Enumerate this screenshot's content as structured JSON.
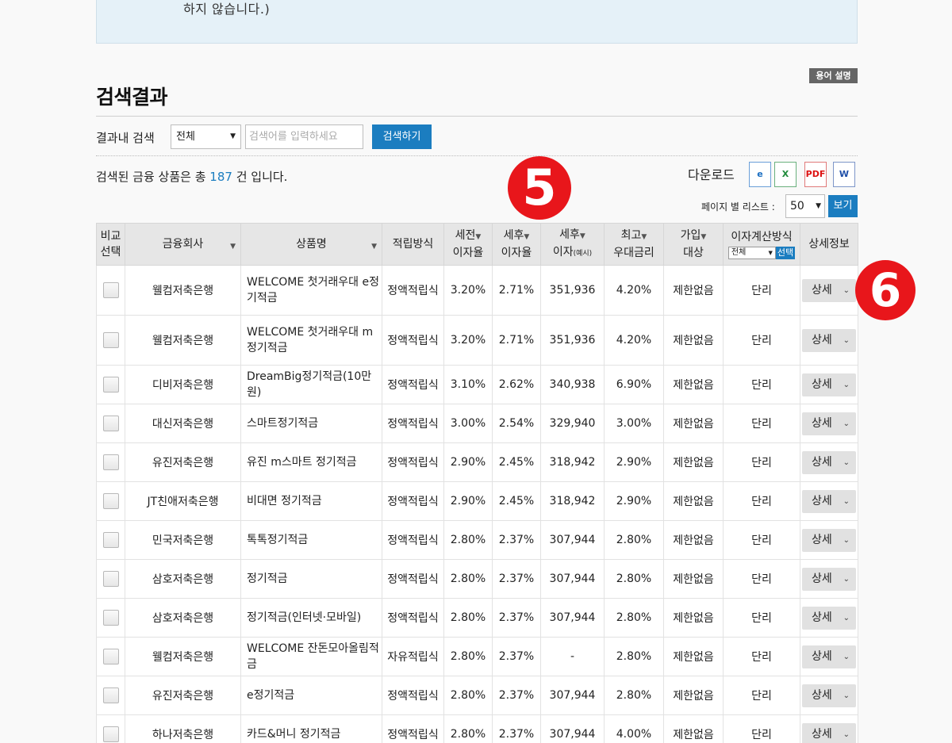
{
  "notice": {
    "text": "하지 않습니다.)"
  },
  "glossary_label": "용어 설명",
  "page_title": "검색결과",
  "search": {
    "label": "결과내 검색",
    "scope_value": "전체",
    "placeholder": "검색어를 입력하세요",
    "button": "검색하기"
  },
  "result": {
    "prefix": "검색된 금융 상품은 총",
    "count": "187",
    "suffix": "건 입니다."
  },
  "markers": {
    "five": "5",
    "six": "6"
  },
  "download": {
    "label": "다운로드",
    "icons": [
      "ie-icon",
      "excel-icon",
      "pdf-icon",
      "word-icon"
    ],
    "icon_text": {
      "ie": "e",
      "xls": "X",
      "pdf": "PDF",
      "doc": "W"
    }
  },
  "perpage": {
    "label": "페이지 별 리스트 :",
    "value": "50",
    "button": "보기"
  },
  "table": {
    "headers": {
      "compare_1": "비교",
      "compare_2": "선택",
      "company": "금융회사",
      "product": "상품명",
      "method": "적립방식",
      "pre_tax_1": "세전",
      "pre_tax_2": "이자율",
      "post_tax_1": "세후",
      "post_tax_2": "이자율",
      "post_int_1": "세후",
      "post_int_2": "이자",
      "post_int_note": "(예시)",
      "max_1": "최고",
      "max_2": "우대금리",
      "join_1": "가입",
      "join_2": "대상",
      "calc_title": "이자계산방식",
      "calc_select": "전체",
      "calc_button": "선택",
      "detail": "상세정보"
    },
    "detail_label": "상세",
    "rows": [
      {
        "company": "웰컴저축은행",
        "product": "WELCOME 첫거래우대 e정기적금",
        "method": "정액적립식",
        "pre": "3.20%",
        "post": "2.71%",
        "interest": "351,936",
        "max": "4.20%",
        "target": "제한없음",
        "calc": "단리"
      },
      {
        "company": "웰컴저축은행",
        "product": "WELCOME 첫거래우대 m정기적금",
        "method": "정액적립식",
        "pre": "3.20%",
        "post": "2.71%",
        "interest": "351,936",
        "max": "4.20%",
        "target": "제한없음",
        "calc": "단리"
      },
      {
        "company": "디비저축은행",
        "product": "DreamBig정기적금(10만원)",
        "method": "정액적립식",
        "pre": "3.10%",
        "post": "2.62%",
        "interest": "340,938",
        "max": "6.90%",
        "target": "제한없음",
        "calc": "단리"
      },
      {
        "company": "대신저축은행",
        "product": "스마트정기적금",
        "method": "정액적립식",
        "pre": "3.00%",
        "post": "2.54%",
        "interest": "329,940",
        "max": "3.00%",
        "target": "제한없음",
        "calc": "단리"
      },
      {
        "company": "유진저축은행",
        "product": "유진 m스마트 정기적금",
        "method": "정액적립식",
        "pre": "2.90%",
        "post": "2.45%",
        "interest": "318,942",
        "max": "2.90%",
        "target": "제한없음",
        "calc": "단리"
      },
      {
        "company": "JT친애저축은행",
        "product": "비대면 정기적금",
        "method": "정액적립식",
        "pre": "2.90%",
        "post": "2.45%",
        "interest": "318,942",
        "max": "2.90%",
        "target": "제한없음",
        "calc": "단리"
      },
      {
        "company": "민국저축은행",
        "product": "톡톡정기적금",
        "method": "정액적립식",
        "pre": "2.80%",
        "post": "2.37%",
        "interest": "307,944",
        "max": "2.80%",
        "target": "제한없음",
        "calc": "단리"
      },
      {
        "company": "삼호저축은행",
        "product": "정기적금",
        "method": "정액적립식",
        "pre": "2.80%",
        "post": "2.37%",
        "interest": "307,944",
        "max": "2.80%",
        "target": "제한없음",
        "calc": "단리"
      },
      {
        "company": "삼호저축은행",
        "product": "정기적금(인터넷·모바일)",
        "method": "정액적립식",
        "pre": "2.80%",
        "post": "2.37%",
        "interest": "307,944",
        "max": "2.80%",
        "target": "제한없음",
        "calc": "단리"
      },
      {
        "company": "웰컴저축은행",
        "product": "WELCOME 잔돈모아올림적금",
        "method": "자유적립식",
        "pre": "2.80%",
        "post": "2.37%",
        "interest": "-",
        "max": "2.80%",
        "target": "제한없음",
        "calc": "단리"
      },
      {
        "company": "유진저축은행",
        "product": "e정기적금",
        "method": "정액적립식",
        "pre": "2.80%",
        "post": "2.37%",
        "interest": "307,944",
        "max": "2.80%",
        "target": "제한없음",
        "calc": "단리"
      },
      {
        "company": "하나저축은행",
        "product": "카드&머니 정기적금",
        "method": "정액적립식",
        "pre": "2.80%",
        "post": "2.37%",
        "interest": "307,944",
        "max": "4.00%",
        "target": "제한없음",
        "calc": "단리"
      }
    ]
  }
}
